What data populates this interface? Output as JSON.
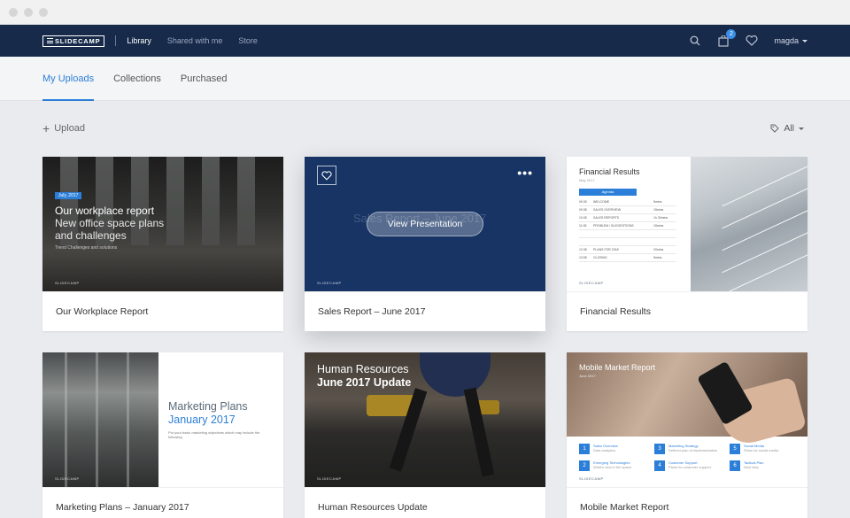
{
  "brand": {
    "logo": "SLIDECAMP"
  },
  "nav": {
    "links": [
      "Library",
      "Shared with me",
      "Store"
    ],
    "cart_badge": "2",
    "username": "magda"
  },
  "tabs": [
    "My Uploads",
    "Collections",
    "Purchased"
  ],
  "toolbar": {
    "upload_label": "Upload",
    "filter_label": "All"
  },
  "cards": [
    {
      "caption": "Our Workplace Report",
      "thumb": {
        "date": "July, 2017",
        "title": "Our workplace report",
        "subtitle_1": "New office space plans",
        "subtitle_2": "and challenges",
        "small": "Trend Challenges and solutions"
      }
    },
    {
      "caption": "Sales Report – June 2017",
      "thumb": {
        "ghost": "Sales Report – June 2017",
        "button": "View Presentation",
        "menu": "•••"
      }
    },
    {
      "caption": "Financial Results",
      "thumb": {
        "title": "Financial Results",
        "date": "May 2017",
        "agenda": "Agenda",
        "rows": [
          {
            "time": "09:30",
            "item": "WELCOME",
            "dur": "5mins"
          },
          {
            "time": "09:35",
            "item": "SALES OVERVIEW",
            "dur": "15mins"
          },
          {
            "time": "10:05",
            "item": "SALES REPORTS",
            "dur": "1h 30mins"
          },
          {
            "time": "11:05",
            "item": "PROBLEM / SUGGESTIONS",
            "dur": "15mins"
          },
          {
            "time": "",
            "item": "",
            "dur": ""
          },
          {
            "time": "",
            "item": "",
            "dur": ""
          },
          {
            "time": "12:35",
            "item": "PLANS FOR 2018",
            "dur": "20mins"
          },
          {
            "time": "13:05",
            "item": "CLOSING",
            "dur": "5mins"
          }
        ]
      }
    },
    {
      "caption": "Marketing Plans – January 2017",
      "thumb": {
        "title_1": "Marketing Plans",
        "title_2": "January 2017",
        "small": "Put your basic marketing objectives which may include the following"
      }
    },
    {
      "caption": "Human Resources Update",
      "thumb": {
        "title_1": "Human Resources",
        "title_2": "June 2017 Update"
      }
    },
    {
      "caption": "Mobile Market Report",
      "thumb": {
        "title": "Mobile Market Report",
        "date": "June 2017",
        "items": [
          {
            "n": "1",
            "label": "Sales Overview",
            "sub": "Data analytics"
          },
          {
            "n": "3",
            "label": "Marketing Strategy",
            "sub": "Defined plan of implementation"
          },
          {
            "n": "5",
            "label": "Social Media",
            "sub": "Plans for social media"
          },
          {
            "n": "2",
            "label": "Emerging Technologies",
            "sub": "What's new in the space"
          },
          {
            "n": "4",
            "label": "Customer Support",
            "sub": "Plans for customer support"
          },
          {
            "n": "6",
            "label": "Tactical Plan",
            "sub": "Next step"
          }
        ]
      }
    }
  ],
  "brand_small": "SLIDECAMP"
}
